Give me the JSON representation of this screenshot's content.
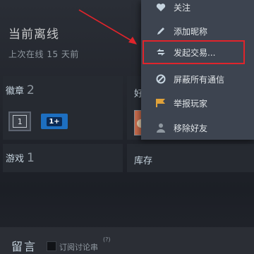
{
  "status": {
    "title": "当前离线",
    "subtitle": "上次在线 15 天前"
  },
  "badges": {
    "label": "徽章",
    "count": "2",
    "badge1_text": "1",
    "badge2_text": "1+"
  },
  "friends": {
    "label": "好友"
  },
  "games": {
    "label": "游戏",
    "count": "1"
  },
  "inventory": {
    "label": "库存"
  },
  "menu": {
    "items": [
      {
        "label": "关注",
        "icon": "heart-icon"
      },
      {
        "label": "添加昵称",
        "icon": "pencil-icon"
      },
      {
        "label": "发起交易...",
        "icon": "trade-arrows-icon"
      },
      {
        "label": "屏蔽所有通信",
        "icon": "block-icon"
      },
      {
        "label": "举报玩家",
        "icon": "flag-icon"
      },
      {
        "label": "移除好友",
        "icon": "remove-friend-icon"
      }
    ]
  },
  "comments": {
    "title": "留言",
    "subscribe_label": "订阅讨论串",
    "help_mark": "(?)"
  },
  "colors": {
    "highlight": "#e0242b",
    "menu_bg": "#3d4450",
    "badge_blue": "#1d6fc1"
  }
}
